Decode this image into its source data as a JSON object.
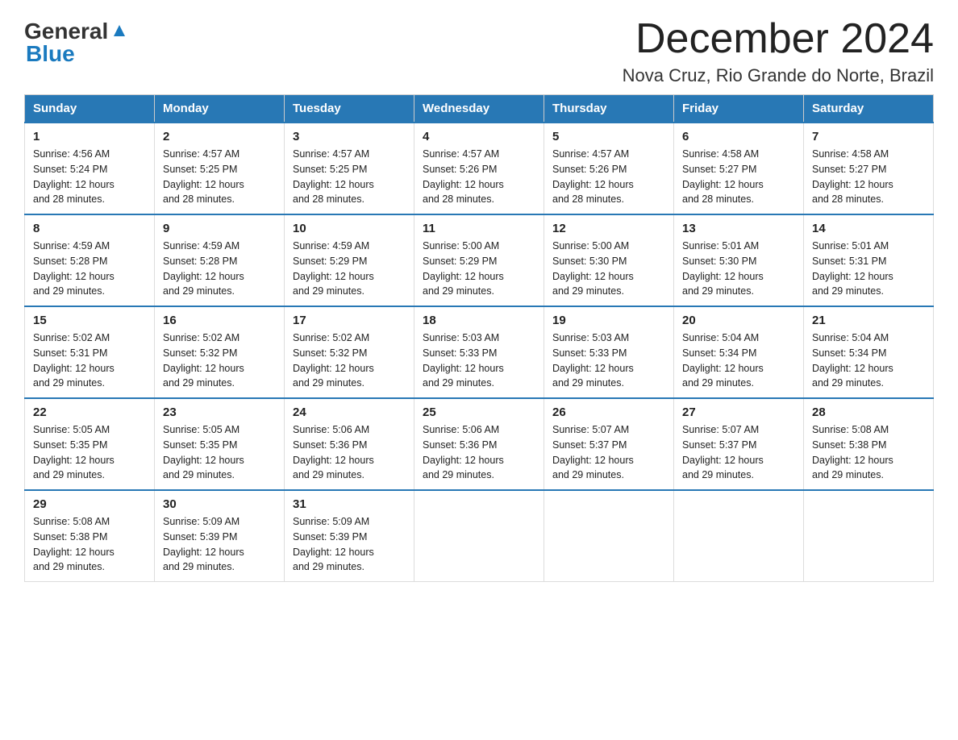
{
  "header": {
    "logo": {
      "general": "General",
      "blue": "Blue"
    },
    "title": "December 2024",
    "subtitle": "Nova Cruz, Rio Grande do Norte, Brazil"
  },
  "weekdays": [
    "Sunday",
    "Monday",
    "Tuesday",
    "Wednesday",
    "Thursday",
    "Friday",
    "Saturday"
  ],
  "weeks": [
    [
      {
        "day": "1",
        "sunrise": "4:56 AM",
        "sunset": "5:24 PM",
        "daylight": "12 hours and 28 minutes."
      },
      {
        "day": "2",
        "sunrise": "4:57 AM",
        "sunset": "5:25 PM",
        "daylight": "12 hours and 28 minutes."
      },
      {
        "day": "3",
        "sunrise": "4:57 AM",
        "sunset": "5:25 PM",
        "daylight": "12 hours and 28 minutes."
      },
      {
        "day": "4",
        "sunrise": "4:57 AM",
        "sunset": "5:26 PM",
        "daylight": "12 hours and 28 minutes."
      },
      {
        "day": "5",
        "sunrise": "4:57 AM",
        "sunset": "5:26 PM",
        "daylight": "12 hours and 28 minutes."
      },
      {
        "day": "6",
        "sunrise": "4:58 AM",
        "sunset": "5:27 PM",
        "daylight": "12 hours and 28 minutes."
      },
      {
        "day": "7",
        "sunrise": "4:58 AM",
        "sunset": "5:27 PM",
        "daylight": "12 hours and 28 minutes."
      }
    ],
    [
      {
        "day": "8",
        "sunrise": "4:59 AM",
        "sunset": "5:28 PM",
        "daylight": "12 hours and 29 minutes."
      },
      {
        "day": "9",
        "sunrise": "4:59 AM",
        "sunset": "5:28 PM",
        "daylight": "12 hours and 29 minutes."
      },
      {
        "day": "10",
        "sunrise": "4:59 AM",
        "sunset": "5:29 PM",
        "daylight": "12 hours and 29 minutes."
      },
      {
        "day": "11",
        "sunrise": "5:00 AM",
        "sunset": "5:29 PM",
        "daylight": "12 hours and 29 minutes."
      },
      {
        "day": "12",
        "sunrise": "5:00 AM",
        "sunset": "5:30 PM",
        "daylight": "12 hours and 29 minutes."
      },
      {
        "day": "13",
        "sunrise": "5:01 AM",
        "sunset": "5:30 PM",
        "daylight": "12 hours and 29 minutes."
      },
      {
        "day": "14",
        "sunrise": "5:01 AM",
        "sunset": "5:31 PM",
        "daylight": "12 hours and 29 minutes."
      }
    ],
    [
      {
        "day": "15",
        "sunrise": "5:02 AM",
        "sunset": "5:31 PM",
        "daylight": "12 hours and 29 minutes."
      },
      {
        "day": "16",
        "sunrise": "5:02 AM",
        "sunset": "5:32 PM",
        "daylight": "12 hours and 29 minutes."
      },
      {
        "day": "17",
        "sunrise": "5:02 AM",
        "sunset": "5:32 PM",
        "daylight": "12 hours and 29 minutes."
      },
      {
        "day": "18",
        "sunrise": "5:03 AM",
        "sunset": "5:33 PM",
        "daylight": "12 hours and 29 minutes."
      },
      {
        "day": "19",
        "sunrise": "5:03 AM",
        "sunset": "5:33 PM",
        "daylight": "12 hours and 29 minutes."
      },
      {
        "day": "20",
        "sunrise": "5:04 AM",
        "sunset": "5:34 PM",
        "daylight": "12 hours and 29 minutes."
      },
      {
        "day": "21",
        "sunrise": "5:04 AM",
        "sunset": "5:34 PM",
        "daylight": "12 hours and 29 minutes."
      }
    ],
    [
      {
        "day": "22",
        "sunrise": "5:05 AM",
        "sunset": "5:35 PM",
        "daylight": "12 hours and 29 minutes."
      },
      {
        "day": "23",
        "sunrise": "5:05 AM",
        "sunset": "5:35 PM",
        "daylight": "12 hours and 29 minutes."
      },
      {
        "day": "24",
        "sunrise": "5:06 AM",
        "sunset": "5:36 PM",
        "daylight": "12 hours and 29 minutes."
      },
      {
        "day": "25",
        "sunrise": "5:06 AM",
        "sunset": "5:36 PM",
        "daylight": "12 hours and 29 minutes."
      },
      {
        "day": "26",
        "sunrise": "5:07 AM",
        "sunset": "5:37 PM",
        "daylight": "12 hours and 29 minutes."
      },
      {
        "day": "27",
        "sunrise": "5:07 AM",
        "sunset": "5:37 PM",
        "daylight": "12 hours and 29 minutes."
      },
      {
        "day": "28",
        "sunrise": "5:08 AM",
        "sunset": "5:38 PM",
        "daylight": "12 hours and 29 minutes."
      }
    ],
    [
      {
        "day": "29",
        "sunrise": "5:08 AM",
        "sunset": "5:38 PM",
        "daylight": "12 hours and 29 minutes."
      },
      {
        "day": "30",
        "sunrise": "5:09 AM",
        "sunset": "5:39 PM",
        "daylight": "12 hours and 29 minutes."
      },
      {
        "day": "31",
        "sunrise": "5:09 AM",
        "sunset": "5:39 PM",
        "daylight": "12 hours and 29 minutes."
      },
      null,
      null,
      null,
      null
    ]
  ],
  "labels": {
    "sunrise": "Sunrise:",
    "sunset": "Sunset:",
    "daylight": "Daylight:"
  }
}
